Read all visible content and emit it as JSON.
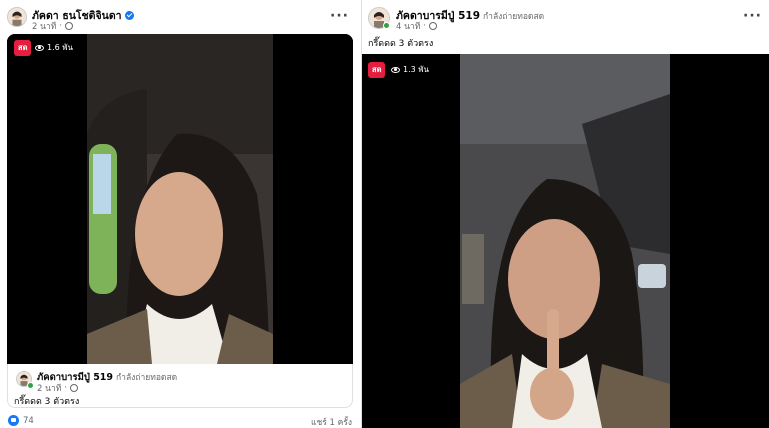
{
  "left_post": {
    "author": "ภัคดา ธนโชติจินดา",
    "time": "2 นาที",
    "dot": "·",
    "more_label": "···",
    "live_badge": "สด",
    "viewers": "1.6 พัน",
    "shared": {
      "author": "ภัคดาบารมีปู่ 519",
      "status": "กำลังถ่ายทอดสด",
      "time": "2 นาที",
      "dot": "·",
      "caption": "กรี๊ดดด 3 ตัวตรง"
    },
    "reactions_count": "74",
    "shares": "แชร์ 1 ครั้ง"
  },
  "right_post": {
    "author": "ภัคดาบารมีปู่ 519",
    "status": "กำลังถ่ายทอดสด",
    "time": "4 นาที",
    "dot": "·",
    "more_label": "···",
    "caption": "กรี๊ดดด 3 ตัวตรง",
    "live_badge": "สด",
    "viewers": "1.3 พัน"
  },
  "colors": {
    "live_red": "#e41e3f",
    "facebook_blue": "#1877f2",
    "online_green": "#31a24c"
  }
}
